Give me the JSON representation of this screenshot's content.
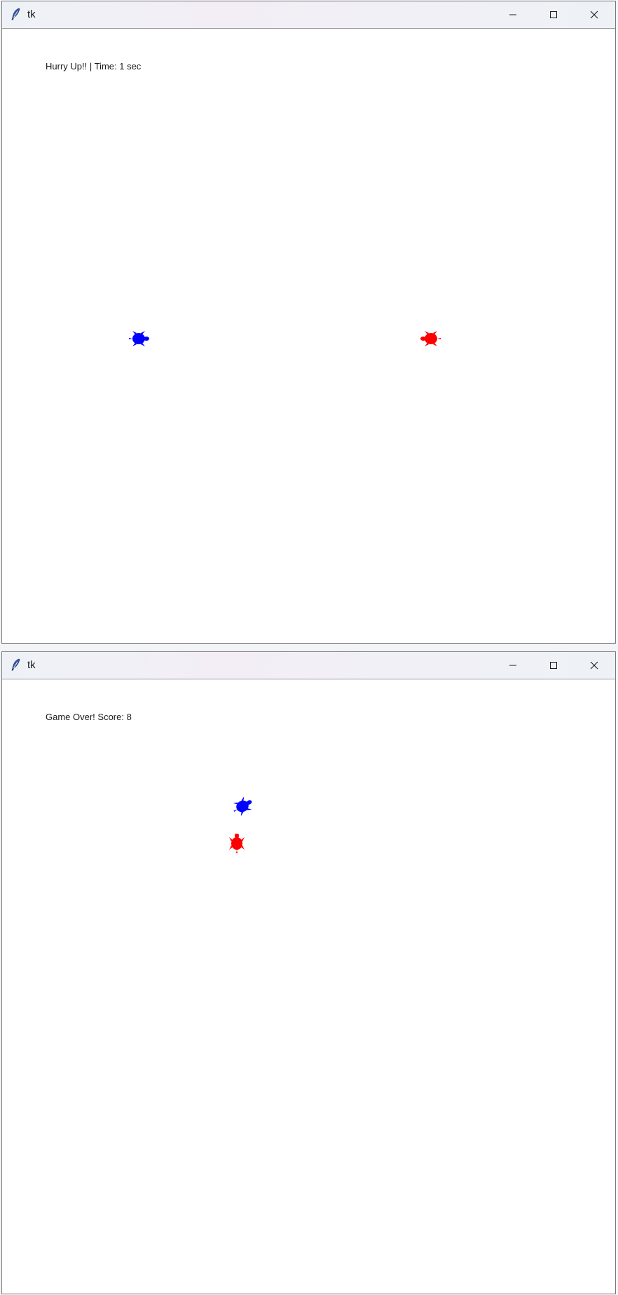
{
  "windows": [
    {
      "title": "tk",
      "status_text": "Hurry Up!! | Time: 1 sec",
      "turtles": [
        {
          "color": "#0000ff",
          "label": "blue turtle"
        },
        {
          "color": "#ff0000",
          "label": "red turtle"
        }
      ]
    },
    {
      "title": "tk",
      "status_text": "Game Over! Score: 8",
      "turtles": [
        {
          "color": "#0000ff",
          "label": "blue turtle"
        },
        {
          "color": "#ff0000",
          "label": "red turtle"
        }
      ]
    }
  ],
  "controls": {
    "minimize_icon": "minimize-icon",
    "maximize_icon": "maximize-icon",
    "close_icon": "close-icon"
  },
  "colors": {
    "blue_turtle": "#0000ff",
    "red_turtle": "#ff0000",
    "canvas_bg": "#ffffff"
  }
}
